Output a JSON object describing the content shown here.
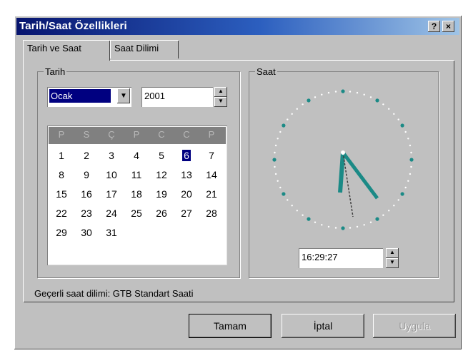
{
  "window": {
    "title": "Tarih/Saat Özellikleri",
    "help_label": "?",
    "close_label": "×"
  },
  "tabs": [
    {
      "label": "Tarih ve Saat"
    },
    {
      "label": "Saat Dilimi"
    }
  ],
  "date_group": {
    "label": "Tarih",
    "month": "Ocak",
    "year": "2001"
  },
  "calendar": {
    "weekdays": [
      "P",
      "S",
      "Ç",
      "P",
      "C",
      "C",
      "P"
    ],
    "weeks": [
      [
        "1",
        "2",
        "3",
        "4",
        "5",
        "6",
        "7"
      ],
      [
        "8",
        "9",
        "10",
        "11",
        "12",
        "13",
        "14"
      ],
      [
        "15",
        "16",
        "17",
        "18",
        "19",
        "20",
        "21"
      ],
      [
        "22",
        "23",
        "24",
        "25",
        "26",
        "27",
        "28"
      ],
      [
        "29",
        "30",
        "31",
        "",
        "",
        "",
        ""
      ]
    ],
    "selected_day": "6"
  },
  "time_group": {
    "label": "Saat",
    "time": "16:29:27"
  },
  "status": "Geçerli saat dilimi: GTB Standart Saati",
  "buttons": {
    "ok": "Tamam",
    "cancel": "İptal",
    "apply": "Uygula"
  },
  "icons": {
    "dropdown": "chevron-down-icon",
    "spin_up": "triangle-up-icon",
    "spin_down": "triangle-down-icon"
  }
}
